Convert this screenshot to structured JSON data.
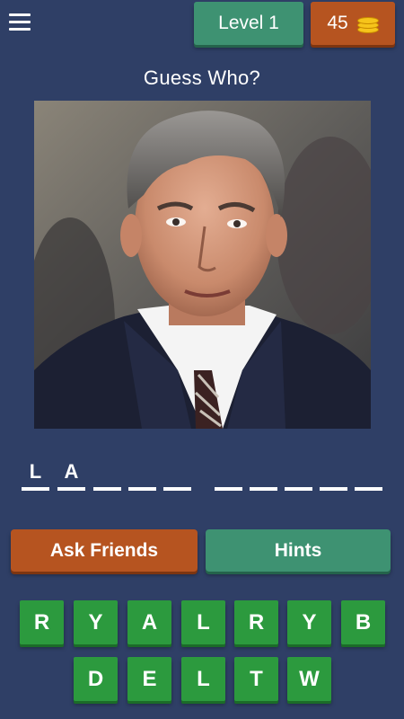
{
  "header": {
    "menu_icon": "hamburger-menu-icon",
    "level_label": "Level 1",
    "coins": "45",
    "coin_icon": "coin-stack-icon"
  },
  "title": "Guess Who?",
  "answer_slots": {
    "word1": [
      "L",
      "A",
      "",
      "",
      ""
    ],
    "word2": [
      "",
      "",
      "",
      "",
      ""
    ]
  },
  "buttons": {
    "ask_friends": "Ask Friends",
    "hints": "Hints"
  },
  "keyboard": {
    "row1": [
      "R",
      "Y",
      "A",
      "L",
      "R",
      "Y",
      "B"
    ],
    "row2": [
      "D",
      "E",
      "L",
      "T",
      "W"
    ]
  },
  "colors": {
    "background": "#2f3f66",
    "green_button": "#3e9272",
    "orange_button": "#b65420",
    "letter_key": "#2c9a3e"
  }
}
